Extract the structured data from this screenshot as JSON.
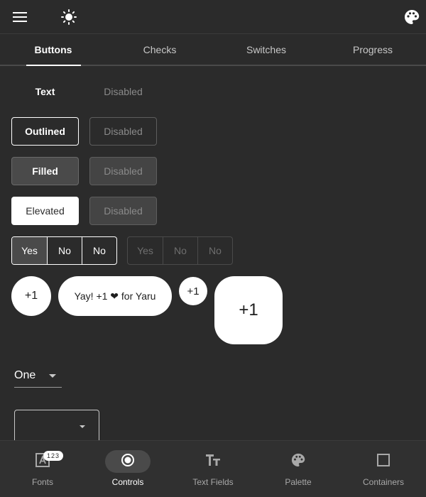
{
  "app_bar": {
    "menu_icon": "menu-icon",
    "theme_icon": "brightness-icon",
    "palette_icon": "palette-icon"
  },
  "tabs": [
    {
      "label": "Buttons",
      "active": true
    },
    {
      "label": "Checks",
      "active": false
    },
    {
      "label": "Switches",
      "active": false
    },
    {
      "label": "Progress",
      "active": false
    }
  ],
  "buttons": {
    "text": "Text",
    "text_disabled": "Disabled",
    "outlined": "Outlined",
    "outlined_disabled": "Disabled",
    "filled": "Filled",
    "filled_disabled": "Disabled",
    "elevated": "Elevated",
    "elevated_disabled": "Disabled"
  },
  "toggle_groups": {
    "enabled": [
      "Yes",
      "No",
      "No"
    ],
    "enabled_selected": "Yes",
    "disabled": [
      "Yes",
      "No",
      "No"
    ]
  },
  "fabs": {
    "regular": "+1",
    "extended": "Yay! +1 ❤ for Yaru",
    "small": "+1",
    "large": "+1"
  },
  "dropdown": {
    "value": "One"
  },
  "nav": {
    "items": [
      {
        "label": "Fonts",
        "icon": "font-icon",
        "badge": "123",
        "active": false
      },
      {
        "label": "Controls",
        "icon": "radio-button-icon",
        "active": true
      },
      {
        "label": "Text Fields",
        "icon": "text-fields-icon",
        "active": false
      },
      {
        "label": "Palette",
        "icon": "palette-icon",
        "active": false
      },
      {
        "label": "Containers",
        "icon": "square-icon",
        "active": false
      }
    ]
  },
  "colors": {
    "background": "#2b2b2b",
    "surface": "#303030",
    "on_surface": "#ffffff",
    "disabled": "#8a8a8a"
  }
}
